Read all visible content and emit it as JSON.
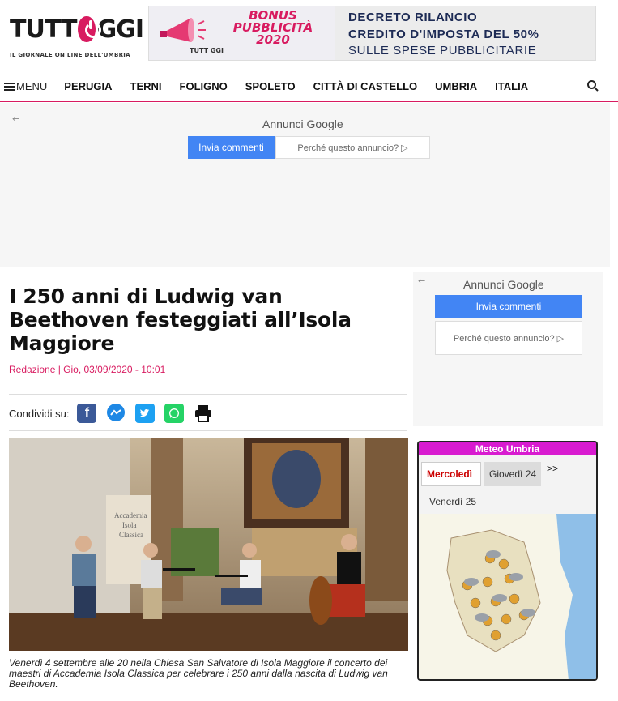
{
  "header": {
    "logo_text_left": "TUTT",
    "logo_text_right": "GGI",
    "logo_tagline": "IL GIORNALE ON LINE DELL'UMBRIA",
    "banner": {
      "bonus_line1": "BONUS",
      "bonus_line2": "PUBBLICITÀ",
      "bonus_line3": "2020",
      "mini_logo": "TUTT GGI",
      "line1": "DECRETO RILANCIO",
      "line2": "CREDITO D'IMPOSTA DEL 50%",
      "line3": "SULLE SPESE PUBBLICITARIE"
    }
  },
  "nav": {
    "menu_label": "MENU",
    "items": [
      "PERUGIA",
      "TERNI",
      "FOLIGNO",
      "SPOLETO",
      "CITTÀ DI CASTELLO",
      "UMBRIA",
      "ITALIA"
    ],
    "search_icon": "search-icon"
  },
  "ad_top": {
    "back": "←",
    "title": "Annunci Google",
    "feedback_button": "Invia commenti",
    "why_button": "Perché questo annuncio? ▷"
  },
  "article": {
    "headline": "I 250 anni di Ludwig van Beethoven festeggiati all’Isola Maggiore",
    "byline": "Redazione | Gio, 03/09/2020 - 10:01",
    "share_label": "Condividi su:",
    "share_icons": [
      "facebook-icon",
      "messenger-icon",
      "twitter-icon",
      "whatsapp-icon",
      "print-icon"
    ],
    "photo_banner_text": "Accademia Isola Classica",
    "caption": "Venerdì 4 settembre alle 20 nella Chiesa San Salvatore di Isola Maggiore il concerto dei maestri di Accademia Isola Classica per celebrare i 250 anni dalla nascita di Ludwig van Beethoven."
  },
  "ad_right": {
    "back": "←",
    "title": "Annunci Google",
    "feedback_button": "Invia commenti",
    "why_button": "Perché questo annuncio? ▷"
  },
  "meteo": {
    "title": "Meteo Umbria",
    "tab_active": "Mercoledì",
    "tab_2": "Giovedì 24",
    "tab_more": ">>",
    "tab_3": "Venerdì 25"
  },
  "colors": {
    "brand": "#d81b60",
    "google_blue": "#4285f4",
    "meteo_header": "#d81bd0"
  }
}
